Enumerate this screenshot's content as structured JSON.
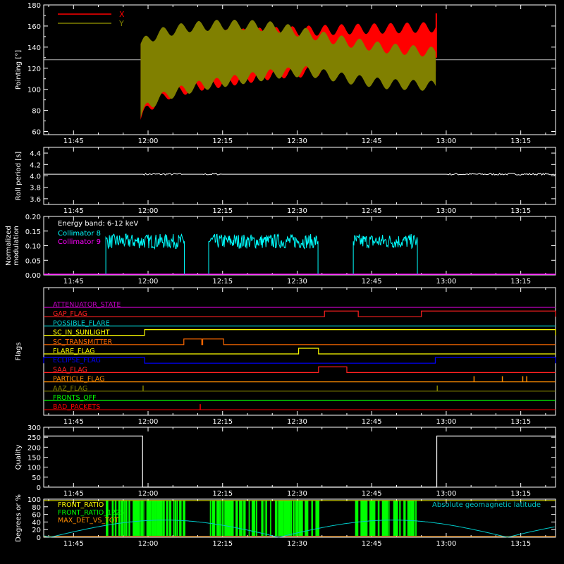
{
  "time_axis": {
    "labels": [
      "11:45",
      "12:00",
      "12:15",
      "12:30",
      "12:45",
      "13:00",
      "13:15"
    ],
    "label_minutes": [
      705,
      720,
      735,
      750,
      765,
      780,
      795
    ],
    "xlim": [
      699,
      802
    ]
  },
  "chart_data": [
    {
      "type": "area",
      "ylabel": "Pointing [°]",
      "ylim": [
        57,
        180
      ],
      "yticks": [
        60,
        80,
        100,
        120,
        140,
        160,
        180
      ],
      "reference_line": 128,
      "x_start": 718.5,
      "x_end": 778.0,
      "legend_position": "top-left",
      "series": [
        {
          "name": "X",
          "color": "#ff0000",
          "upper": [
            [
              718.5,
              148
            ],
            [
              722,
              150
            ],
            [
              730,
              155
            ],
            [
              740,
              158
            ],
            [
              750,
              160
            ],
            [
              760,
              162
            ],
            [
              770,
              163
            ],
            [
              778,
              164
            ]
          ],
          "lower": [
            [
              718.5,
              66
            ],
            [
              720,
              78
            ],
            [
              724,
              90
            ],
            [
              730,
              98
            ],
            [
              738,
              104
            ],
            [
              746,
              110
            ],
            [
              755,
              112
            ],
            [
              766,
              112
            ],
            [
              778,
              112
            ]
          ]
        },
        {
          "name": "Y",
          "color": "#808000",
          "upper": [
            [
              718.5,
              148
            ],
            [
              722,
              158
            ],
            [
              728,
              164
            ],
            [
              734,
              166
            ],
            [
              740,
              166
            ],
            [
              746,
              164
            ],
            [
              752,
              158
            ],
            [
              760,
              150
            ],
            [
              768,
              144
            ],
            [
              778,
              140
            ]
          ],
          "lower": [
            [
              718.5,
              68
            ],
            [
              720,
              80
            ],
            [
              724,
              90
            ],
            [
              730,
              98
            ],
            [
              738,
              104
            ],
            [
              746,
              110
            ],
            [
              752,
              112
            ],
            [
              760,
              105
            ],
            [
              768,
              100
            ],
            [
              778,
              98
            ]
          ]
        }
      ],
      "spike_end": {
        "x": 778,
        "y": 172
      }
    },
    {
      "type": "line",
      "ylabel": "Roll period [s]",
      "ylim": [
        3.5,
        4.5
      ],
      "yticks": [
        "3.6",
        "3.8",
        "4.0",
        "4.2",
        "4.4"
      ],
      "ytick_values": [
        3.6,
        3.8,
        4.0,
        4.2,
        4.4
      ],
      "baseline": 4.03,
      "color": "#ffffff"
    },
    {
      "type": "line",
      "ylabel": "Normalized modulation",
      "ylim": [
        0,
        0.2
      ],
      "yticks": [
        "0.00",
        "0.05",
        "0.10",
        "0.15",
        "0.20"
      ],
      "ytick_values": [
        0,
        0.05,
        0.1,
        0.15,
        0.2
      ],
      "legend_title": "Energy band: 6-12 keV",
      "series": [
        {
          "name": "Collimator 8",
          "color": "#00ffff",
          "segments": [
            [
              711.5,
              727.3
            ],
            [
              732.2,
              754.2
            ],
            [
              761.3,
              774.2
            ]
          ],
          "level": 0.115
        },
        {
          "name": "Collimator 9",
          "color": "#ff00ff",
          "level": 0
        }
      ]
    },
    {
      "type": "line",
      "ylabel": "Flags",
      "flags": [
        {
          "name": "ATTENUATOR_STATE",
          "color": "#c000c0",
          "steps": []
        },
        {
          "name": "GAP_FLAG",
          "color": "#ff2020",
          "steps": [
            [
              755.5,
              762.3
            ],
            [
              775.0,
              802
            ]
          ]
        },
        {
          "name": "POSSIBLE_FLARE",
          "color": "#00c8c8",
          "steps": []
        },
        {
          "name": "SC_IN_SUNLIGHT",
          "color": "#ffff00",
          "steps": [
            [
              719.3,
              802
            ]
          ]
        },
        {
          "name": "SC_TRANSMITTER",
          "color": "#ff6a00",
          "steps": [
            [
              727.2,
              730.8
            ],
            [
              731.0,
              735.2
            ]
          ]
        },
        {
          "name": "FLARE_FLAG",
          "color": "#ffff00",
          "steps": [
            [
              750.3,
              754.3
            ]
          ]
        },
        {
          "name": "ECLIPSE_FLAG",
          "color": "#0000ff",
          "steps": [
            [
              699,
              719.3
            ],
            [
              777.8,
              802
            ]
          ]
        },
        {
          "name": "SAA_FLAG",
          "color": "#ff2020",
          "steps": [
            [
              754.3,
              760.0
            ]
          ]
        },
        {
          "name": "PARTICLE_FLAG",
          "color": "#ff8c00",
          "spikes": [
            785.6,
            791.3,
            795.4,
            796.2
          ]
        },
        {
          "name": "AAZ_FLAG",
          "color": "#808000",
          "spikes": [
            719.0,
            778.2
          ]
        },
        {
          "name": "FRONTS_OFF",
          "color": "#00ff00",
          "steps": []
        },
        {
          "name": "BAD_PACKETS",
          "color": "#ff0000",
          "spikes": [
            730.5
          ]
        }
      ]
    },
    {
      "type": "line",
      "ylabel": "Quality",
      "ylim": [
        0,
        300
      ],
      "yticks": [
        "0",
        "50",
        "100",
        "150",
        "200",
        "250",
        "300"
      ],
      "ytick_values": [
        0,
        50,
        100,
        150,
        200,
        250,
        300
      ],
      "high_value": 256,
      "segments": [
        [
          699,
          718.9
        ],
        [
          778.1,
          802
        ]
      ],
      "color": "#ffffff"
    },
    {
      "type": "line",
      "ylabel": "Degrees or %",
      "ylim": [
        0,
        100
      ],
      "yticks": [
        "0",
        "20",
        "40",
        "60",
        "80",
        "100"
      ],
      "ytick_values": [
        0,
        20,
        40,
        60,
        80,
        100
      ],
      "legend_right": "Absolute geomagnetic latitude",
      "series": [
        {
          "name": "FRONT_RATIO",
          "color": "#ffff00"
        },
        {
          "name": "FRONT_RATIO_1225",
          "color": "#00ff00",
          "blocks": [
            [
              711.5,
              727.3
            ],
            [
              732.2,
              754.2
            ],
            [
              761.3,
              774.2
            ]
          ]
        },
        {
          "name": "MAX_DET_VS_TOT",
          "color": "#ff8c00"
        },
        {
          "name": "Absolute geomagnetic latitude",
          "color": "#00c8c8",
          "peak": 45,
          "period": 46,
          "zero_at": 700.3
        }
      ]
    }
  ]
}
